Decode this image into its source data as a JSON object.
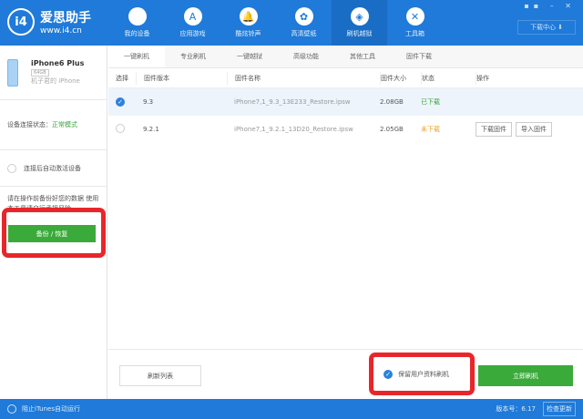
{
  "header": {
    "logo_title": "爱思助手",
    "logo_url": "www.i4.cn",
    "logo_mark": "i4",
    "nav": [
      {
        "label": "我的设备",
        "icon": "apple-icon"
      },
      {
        "label": "应用游戏",
        "icon": "app-store-icon"
      },
      {
        "label": "酷炫铃声",
        "icon": "bell-icon"
      },
      {
        "label": "高清壁纸",
        "icon": "wallpaper-icon"
      },
      {
        "label": "刷机越狱",
        "icon": "dropbox-icon"
      },
      {
        "label": "工具箱",
        "icon": "tools-icon"
      }
    ],
    "download_center": "下载中心 ⬇"
  },
  "sidebar": {
    "device_name": "iPhone6 Plus",
    "capacity": "64GB",
    "owner": "机子君的 iPhone",
    "status_label": "设备连接状态：",
    "status_value": "正常模式",
    "auto_activate": "连接后自动激活设备",
    "warning": "请在操作前备份好您的数据 使用本工具请自行承担风险",
    "backup_button": "备份 / 恢复"
  },
  "tabs": [
    "一键刷机",
    "专业刷机",
    "一键越狱",
    "高级功能",
    "其他工具",
    "固件下载"
  ],
  "table": {
    "headers": [
      "选择",
      "固件版本",
      "固件名称",
      "固件大小",
      "状态",
      "操作"
    ],
    "rows": [
      {
        "version": "9.3",
        "name": "iPhone7,1_9.3_13E233_Restore.ipsw",
        "size": "2.08GB",
        "status": "已下载",
        "selected": true
      },
      {
        "version": "9.2.1",
        "name": "iPhone7,1_9.2.1_13D20_Restore.ipsw",
        "size": "2.05GB",
        "status": "未下载",
        "selected": false,
        "actions": [
          "下载固件",
          "导入固件"
        ]
      }
    ]
  },
  "bottom": {
    "refresh": "刷新列表",
    "keep_data": "保留用户资料刷机",
    "flash_now": "立即刷机"
  },
  "statusbar": {
    "block_itunes": "阻止iTunes自动运行",
    "version": "版本号：6.17",
    "check_update": "检查更新"
  }
}
